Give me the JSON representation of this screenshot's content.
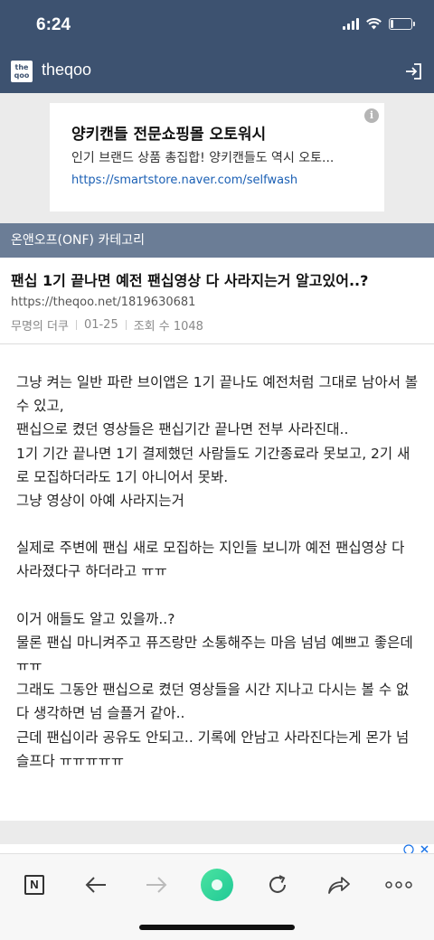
{
  "status_bar": {
    "time": "6:24"
  },
  "app_bar": {
    "logo_line1": "the",
    "logo_line2": "qoo",
    "site_name": "theqoo"
  },
  "ad": {
    "title": "양키캔들 전문쇼핑몰 오토워시",
    "description": "인기 브랜드 상품 총집합! 양키캔들도 역시 오토...",
    "url": "https://smartstore.naver.com/selfwash",
    "info_glyph": "i"
  },
  "category": {
    "label": "온앤오프(ONF) 카테고리"
  },
  "post": {
    "title": "팬십 1기 끝나면 예전 팬십영상 다 사라지는거 알고있어..?",
    "link": "https://theqoo.net/1819630681",
    "author": "무명의 더쿠",
    "date": "01-25",
    "views_label": "조회 수 1048",
    "paragraphs": [
      "그냥 켜는 일반 파란 브이앱은 1기 끝나도 예전처럼 그대로 남아서 볼 수 있고,\n팬십으로 켰던 영상들은 팬십기간 끝나면 전부 사라진대..\n1기 기간 끝나면 1기 결제했던 사람들도 기간종료라 못보고, 2기 새로 모집하더라도 1기 아니어서 못봐.\n그냥 영상이 아예 사라지는거",
      "실제로 주변에 팬십 새로 모집하는 지인들 보니까 예전 팬십영상 다 사라졌다구 하더라고 ㅠㅠ",
      "이거 애들도 알고 있을까..?\n물론 팬십 마니켜주고 퓨즈랑만 소통해주는 마음 넘넘 예쁘고 좋은데 ㅠㅠ\n그래도 그동안 팬십으로 켰던 영상들을 시간 지나고 다시는 볼 수 없다 생각하면 넘 슬플거 같아..\n근데 팬십이라 공유도 안되고.. 기록에 안남고 사라진다는게 몬가 넘 슬프다 ㅠㅠㅠㅠㅠ"
    ]
  },
  "toolbar": {
    "items": [
      "naver-icon",
      "back-icon",
      "forward-icon",
      "green-dot-icon",
      "reload-icon",
      "share-icon",
      "more-icon"
    ],
    "naver_glyph": "N"
  },
  "colors": {
    "header": "#3d5270",
    "category": "#6b7d96",
    "link": "#1a5fb4",
    "accent_green": "#20c997"
  }
}
